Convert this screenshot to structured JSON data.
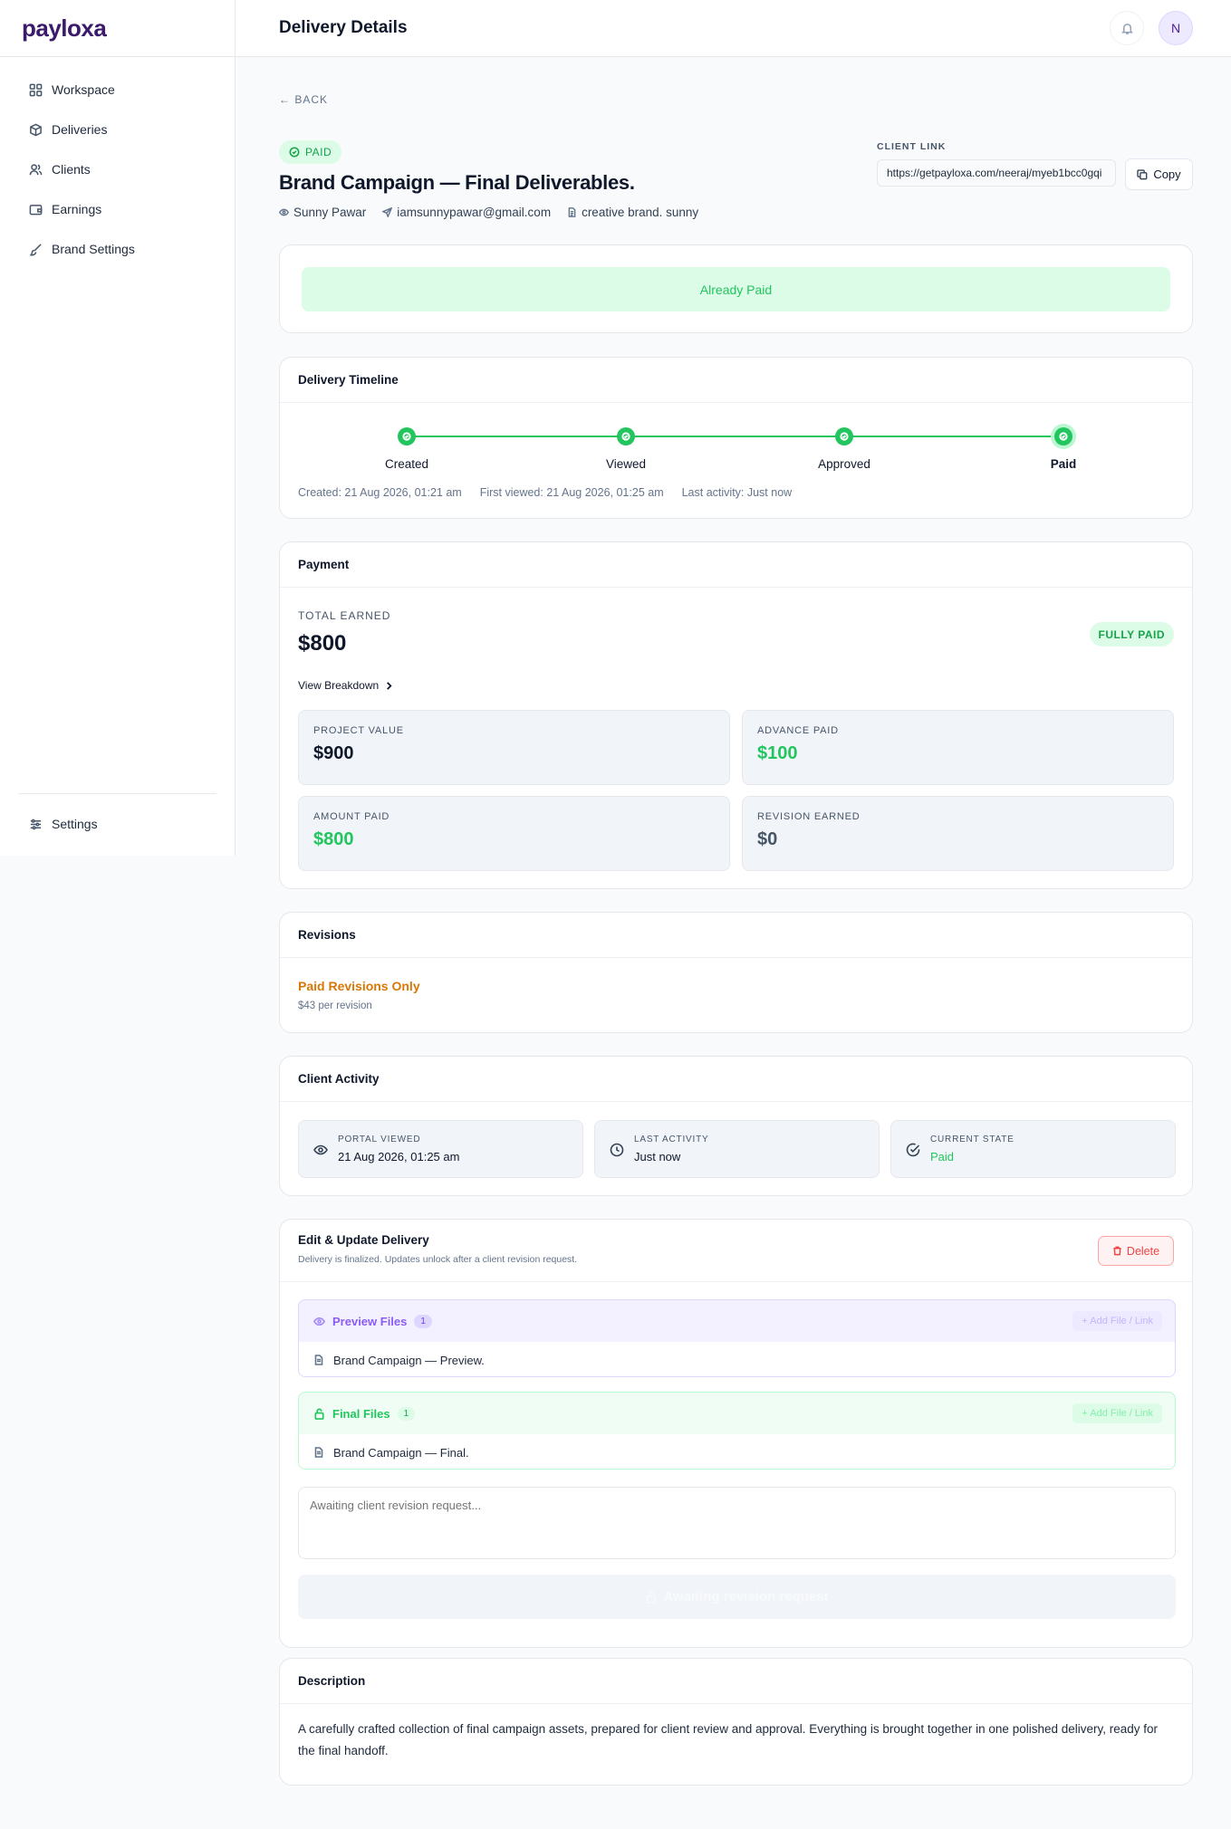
{
  "brand": {
    "name": "payloxa",
    "accent": "#4c1d95",
    "success": "#22c55e"
  },
  "sidebar": {
    "items": [
      {
        "label": "Workspace",
        "icon": "grid-icon"
      },
      {
        "label": "Deliveries",
        "icon": "box-icon"
      },
      {
        "label": "Clients",
        "icon": "users-icon"
      },
      {
        "label": "Earnings",
        "icon": "wallet-icon"
      },
      {
        "label": "Brand Settings",
        "icon": "brush-icon"
      }
    ],
    "settings_label": "Settings"
  },
  "header": {
    "title": "Delivery Details",
    "avatar_initial": "N"
  },
  "page": {
    "back_label": "← BACK",
    "status_badge": "PAID",
    "title": "Brand Campaign — Final Deliverables.",
    "client_name": "Sunny Pawar",
    "client_email": "iamsunnypawar@gmail.com",
    "client_company": "creative brand. sunny",
    "client_link_label": "CLIENT LINK",
    "client_link_value": "https://getpayloxa.com/neeraj/myeb1bcc0gqi",
    "copy_label": "Copy"
  },
  "paid_banner": "Already Paid",
  "timeline": {
    "title": "Delivery Timeline",
    "steps": [
      "Created",
      "Viewed",
      "Approved",
      "Paid"
    ],
    "created": "Created: 21 Aug 2026, 01:21 am",
    "first_viewed": "First viewed: 21 Aug 2026, 01:25 am",
    "last_activity": "Last activity: Just now"
  },
  "payment": {
    "title": "Payment",
    "total_label": "TOTAL EARNED",
    "total_value": "$800",
    "status": "FULLY PAID",
    "breakdown_label": "View Breakdown",
    "stats": [
      {
        "label": "PROJECT VALUE",
        "value": "$900",
        "color": "#0f172a"
      },
      {
        "label": "ADVANCE PAID",
        "value": "$100",
        "color": "#22c55e"
      },
      {
        "label": "AMOUNT PAID",
        "value": "$800",
        "color": "#22c55e"
      },
      {
        "label": "REVISION EARNED",
        "value": "$0",
        "color": "#475569"
      }
    ]
  },
  "revisions": {
    "title": "Revisions",
    "policy": "Paid Revisions Only",
    "price": "$43 per revision"
  },
  "activity": {
    "title": "Client Activity",
    "items": [
      {
        "label": "PORTAL VIEWED",
        "value": "21 Aug 2026, 01:25 am",
        "icon": "eye-icon"
      },
      {
        "label": "LAST ACTIVITY",
        "value": "Just now",
        "icon": "clock-icon"
      },
      {
        "label": "CURRENT STATE",
        "value": "Paid",
        "icon": "check-circle-icon"
      }
    ]
  },
  "edit": {
    "title": "Edit & Update Delivery",
    "subtitle": "Delivery is finalized. Updates unlock after a client revision request.",
    "delete_label": "Delete",
    "preview": {
      "label": "Preview Files",
      "count": "1",
      "add_label": "+ Add File / Link",
      "file": "Brand Campaign — Preview."
    },
    "final": {
      "label": "Final Files",
      "count": "1",
      "add_label": "+ Add File / Link",
      "file": "Brand Campaign — Final."
    },
    "textarea_placeholder": "Awaiting client revision request...",
    "await_label": "Awaiting revision request"
  },
  "description": {
    "title": "Description",
    "text": "A carefully crafted collection of final campaign assets, prepared for client review and approval. Everything is brought together in one polished delivery, ready for the final handoff."
  }
}
